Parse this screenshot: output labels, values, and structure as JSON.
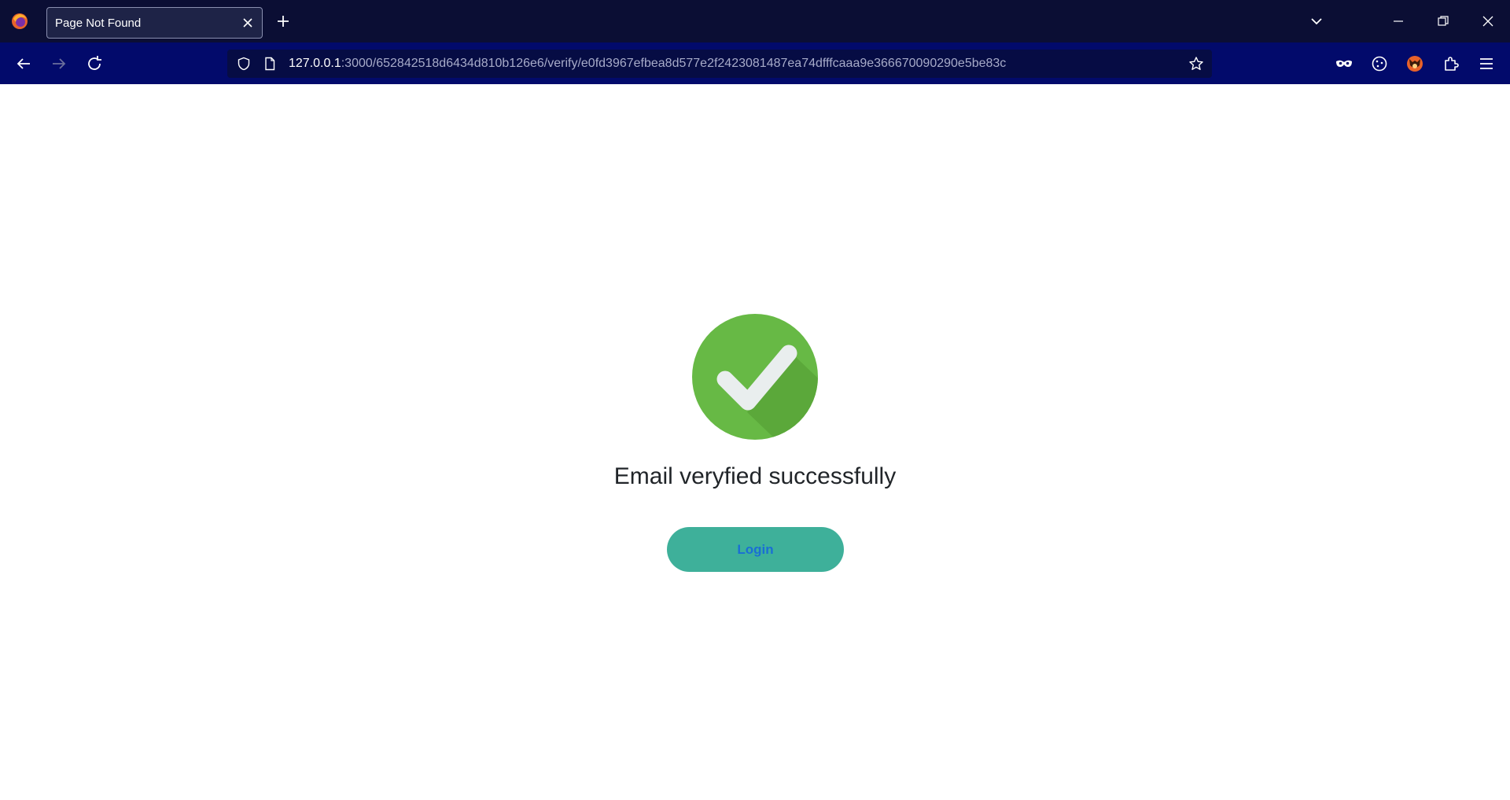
{
  "browser": {
    "tab": {
      "title": "Page Not Found"
    },
    "url": {
      "host": "127.0.0.1",
      "path": ":3000/652842518d6434d810b126e6/verify/e0fd3967efbea8d577e2f2423081487ea74dfffcaaa9e366670090290e5be83c"
    },
    "icons": {
      "app": "firefox-logo",
      "tab_close": "close-icon",
      "new_tab": "plus-icon",
      "list_tabs": "chevron-down-icon",
      "back": "back-arrow-icon",
      "forward": "forward-arrow-icon",
      "reload": "reload-icon",
      "shield": "shield-icon",
      "page": "page-icon",
      "bookmark": "star-icon",
      "private": "mask-icon",
      "cookie": "cookie-icon",
      "profile": "fox-avatar-icon",
      "extensions": "puzzle-icon",
      "menu": "hamburger-menu-icon"
    }
  },
  "page": {
    "message": "Email veryfied successfully",
    "login_label": "Login",
    "colors": {
      "check_green": "#67b945",
      "button_bg": "#3eb09a",
      "button_text": "#1a6fd4"
    }
  }
}
